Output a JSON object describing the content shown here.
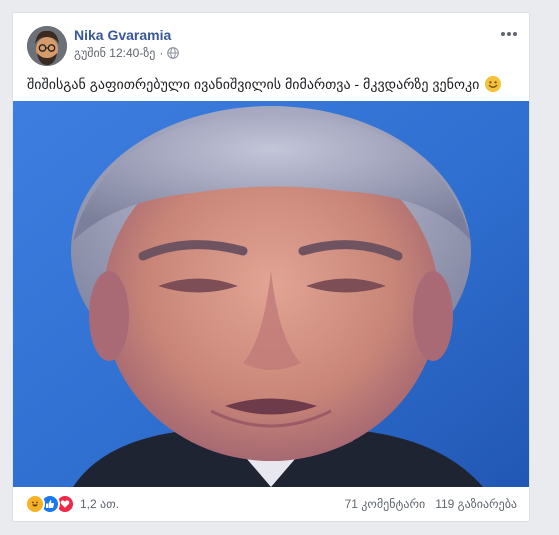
{
  "post": {
    "author": "Nika Gvaramia",
    "timestamp": "გუშინ 12:40-ზე",
    "separator": "·",
    "privacy_icon": "globe-icon",
    "more_icon": "more-options-icon",
    "text": "შიშისგან გაფითრებული ივანიშვილის მიმართვა - მკვდარზე ვენოკი",
    "emoji": "smile-emoji"
  },
  "footer": {
    "reaction_icons": [
      "haha-reaction-icon",
      "like-reaction-icon",
      "love-reaction-icon"
    ],
    "reaction_count": "1,2 ათ.",
    "comments": "71 კომენტარი",
    "shares": "119 გაზიარება"
  },
  "colors": {
    "author_link": "#385898",
    "meta_text": "#616770",
    "background": "#e9ebee",
    "card": "#ffffff",
    "photo_bg": "#2f6fd0"
  }
}
